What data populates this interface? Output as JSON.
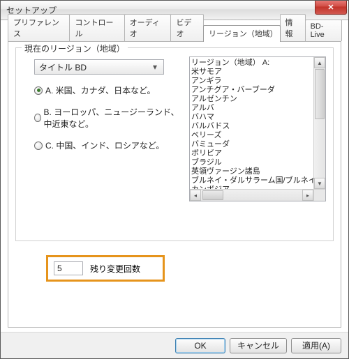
{
  "window": {
    "title": "セットアップ"
  },
  "tabs": {
    "items": [
      {
        "label": "プリファレンス"
      },
      {
        "label": "コントロール"
      },
      {
        "label": "オーディオ"
      },
      {
        "label": "ビデオ"
      },
      {
        "label": "リージョン（地域）"
      },
      {
        "label": "情報"
      },
      {
        "label": "BD-Live"
      }
    ],
    "active_index": 4
  },
  "region": {
    "group_title": "現在のリージョン（地域）",
    "combo_value": "タイトル BD",
    "options": [
      {
        "label": "A. 米国、カナダ、日本など。",
        "checked": true
      },
      {
        "label": "B. ヨーロッパ、ニュージーランド、中近東など。",
        "checked": false
      },
      {
        "label": "C. 中国、インド、ロシアなど。",
        "checked": false
      }
    ],
    "list": [
      "リージョン（地域） A:",
      "米サモア",
      "アンギラ",
      "アンチグア・バーブーダ",
      "アルゼンチン",
      "アルバ",
      "バハマ",
      "バルバドス",
      "ベリーズ",
      "バミューダ",
      "ボリビア",
      "ブラジル",
      "英領ヴァージン諸島",
      "ブルネイ・ダルサラーム国/ブルネイ",
      "カンボジア"
    ],
    "remaining": {
      "value": "5",
      "label": "残り変更回数"
    }
  },
  "buttons": {
    "ok": "OK",
    "cancel": "キャンセル",
    "apply": "適用(A)"
  }
}
